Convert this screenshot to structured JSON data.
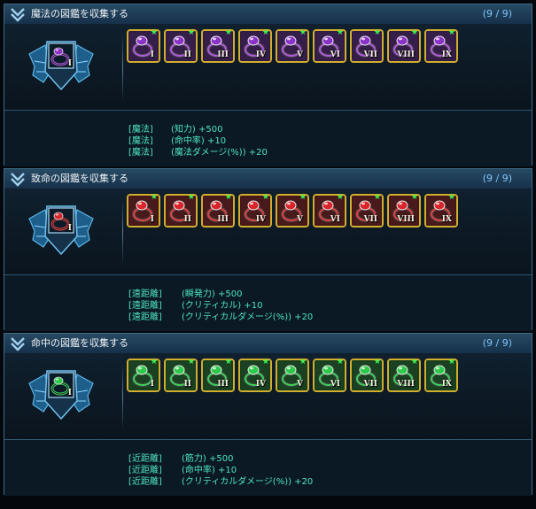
{
  "collections": [
    {
      "title": "魔法の図鑑を収集する",
      "count": "(9 / 9)",
      "theme": "purple",
      "colors": {
        "gem": "#8b32c9",
        "band": "#b25ae0",
        "glow": "#6f2aa8"
      },
      "emblem": {
        "icon": "purple-ring-emblem-icon",
        "numeral": "I"
      },
      "items": [
        {
          "numeral": "I"
        },
        {
          "numeral": "II"
        },
        {
          "numeral": "III"
        },
        {
          "numeral": "IV"
        },
        {
          "numeral": "V"
        },
        {
          "numeral": "VI"
        },
        {
          "numeral": "VII"
        },
        {
          "numeral": "VIII"
        },
        {
          "numeral": "IX"
        }
      ],
      "effects": [
        {
          "category": "[魔法]",
          "stat": "(知力) +500"
        },
        {
          "category": "[魔法]",
          "stat": "(命中率) +10"
        },
        {
          "category": "[魔法]",
          "stat": "(魔法ダメージ(%)) +20"
        }
      ]
    },
    {
      "title": "致命の図鑑を収集する",
      "count": "(9 / 9)",
      "theme": "red",
      "colors": {
        "gem": "#d8242a",
        "band": "#e04040",
        "glow": "#a21f24"
      },
      "emblem": {
        "icon": "red-ring-emblem-icon",
        "numeral": "I"
      },
      "items": [
        {
          "numeral": "I"
        },
        {
          "numeral": "II"
        },
        {
          "numeral": "III"
        },
        {
          "numeral": "IV"
        },
        {
          "numeral": "V"
        },
        {
          "numeral": "VI"
        },
        {
          "numeral": "VII"
        },
        {
          "numeral": "VIII"
        },
        {
          "numeral": "IX"
        }
      ],
      "effects": [
        {
          "category": "[遠距離]",
          "stat": "(瞬発力) +500"
        },
        {
          "category": "[遠距離]",
          "stat": "(クリティカル) +10"
        },
        {
          "category": "[遠距離]",
          "stat": "(クリティカルダメージ(%)) +20"
        }
      ]
    },
    {
      "title": "命中の図鑑を収集する",
      "count": "(9 / 9)",
      "theme": "green",
      "colors": {
        "gem": "#2ec94a",
        "band": "#3bd25a",
        "glow": "#1f8f35"
      },
      "emblem": {
        "icon": "green-ring-emblem-icon",
        "numeral": "I"
      },
      "items": [
        {
          "numeral": "I"
        },
        {
          "numeral": "II"
        },
        {
          "numeral": "III"
        },
        {
          "numeral": "IV"
        },
        {
          "numeral": "V"
        },
        {
          "numeral": "VI"
        },
        {
          "numeral": "VII"
        },
        {
          "numeral": "VIII"
        },
        {
          "numeral": "IX"
        }
      ],
      "effects": [
        {
          "category": "[近距離]",
          "stat": "(筋力) +500"
        },
        {
          "category": "[近距離]",
          "stat": "(命中率) +10"
        },
        {
          "category": "[近距離]",
          "stat": "(クリティカルダメージ(%)) +20"
        }
      ]
    }
  ],
  "ui_colors": {
    "border": "#3e6a86",
    "frame": "#d2ae2e",
    "effect_text": "#4fe3c0",
    "count_text": "#7ec7ff",
    "star": "#3cf050"
  }
}
